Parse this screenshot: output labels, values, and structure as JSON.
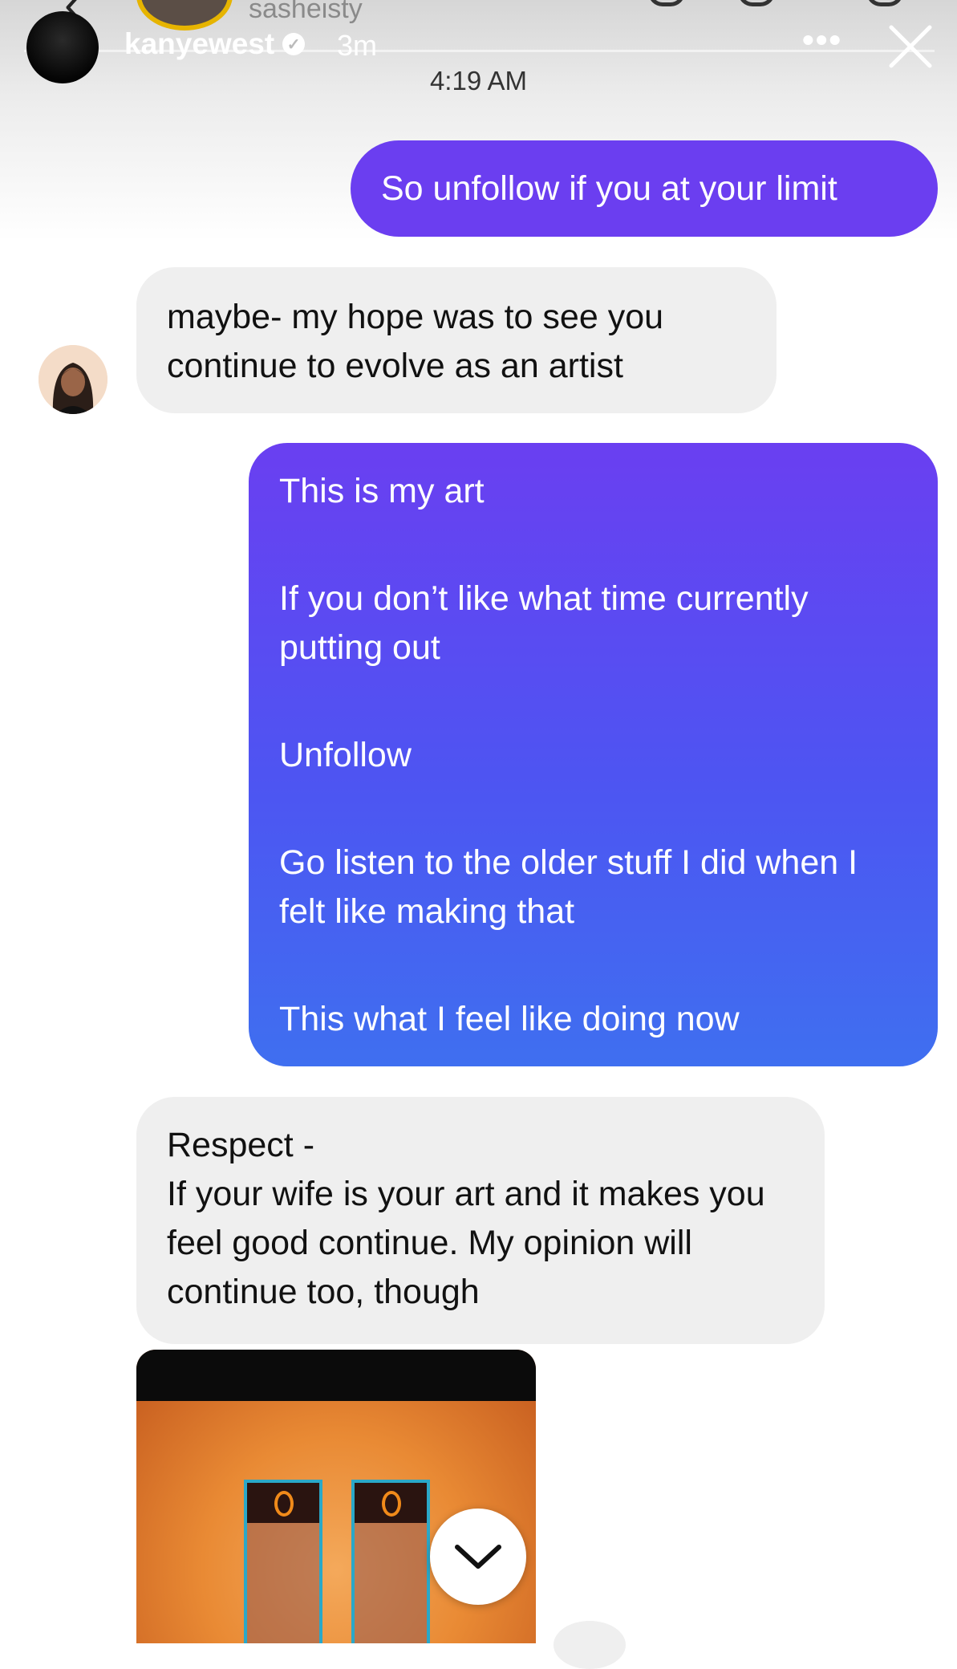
{
  "story": {
    "previous_username": "sasheisty",
    "username": "kanyewest",
    "age": "3m",
    "more_icon": "more-horizontal-icon",
    "close_icon": "close-icon"
  },
  "conversation": {
    "timestamp": "4:19 AM",
    "messages": [
      {
        "from": "me",
        "text": "So unfollow if you at your limit"
      },
      {
        "from": "them",
        "text": "maybe- my hope was to see you continue to evolve as an artist"
      },
      {
        "from": "me",
        "paragraphs": [
          "This is my art",
          "If you don’t like what time currently putting out",
          "Unfollow",
          "Go listen to the older stuff I did when I felt like making that",
          "This what I feel like doing now"
        ]
      },
      {
        "from": "them",
        "lines": [
          "Respect -",
          "If your wife is your art and it makes you feel good continue. My opinion will continue too, though"
        ]
      }
    ]
  },
  "colors": {
    "outgoing_bubble": "#6b3ef0",
    "outgoing_gradient_end": "#3f6ff0",
    "incoming_bubble": "#efefef",
    "media_orange": "#e98a34"
  },
  "icons": {
    "scroll_down": "chevron-down-icon",
    "verified": "verified-badge-icon"
  }
}
